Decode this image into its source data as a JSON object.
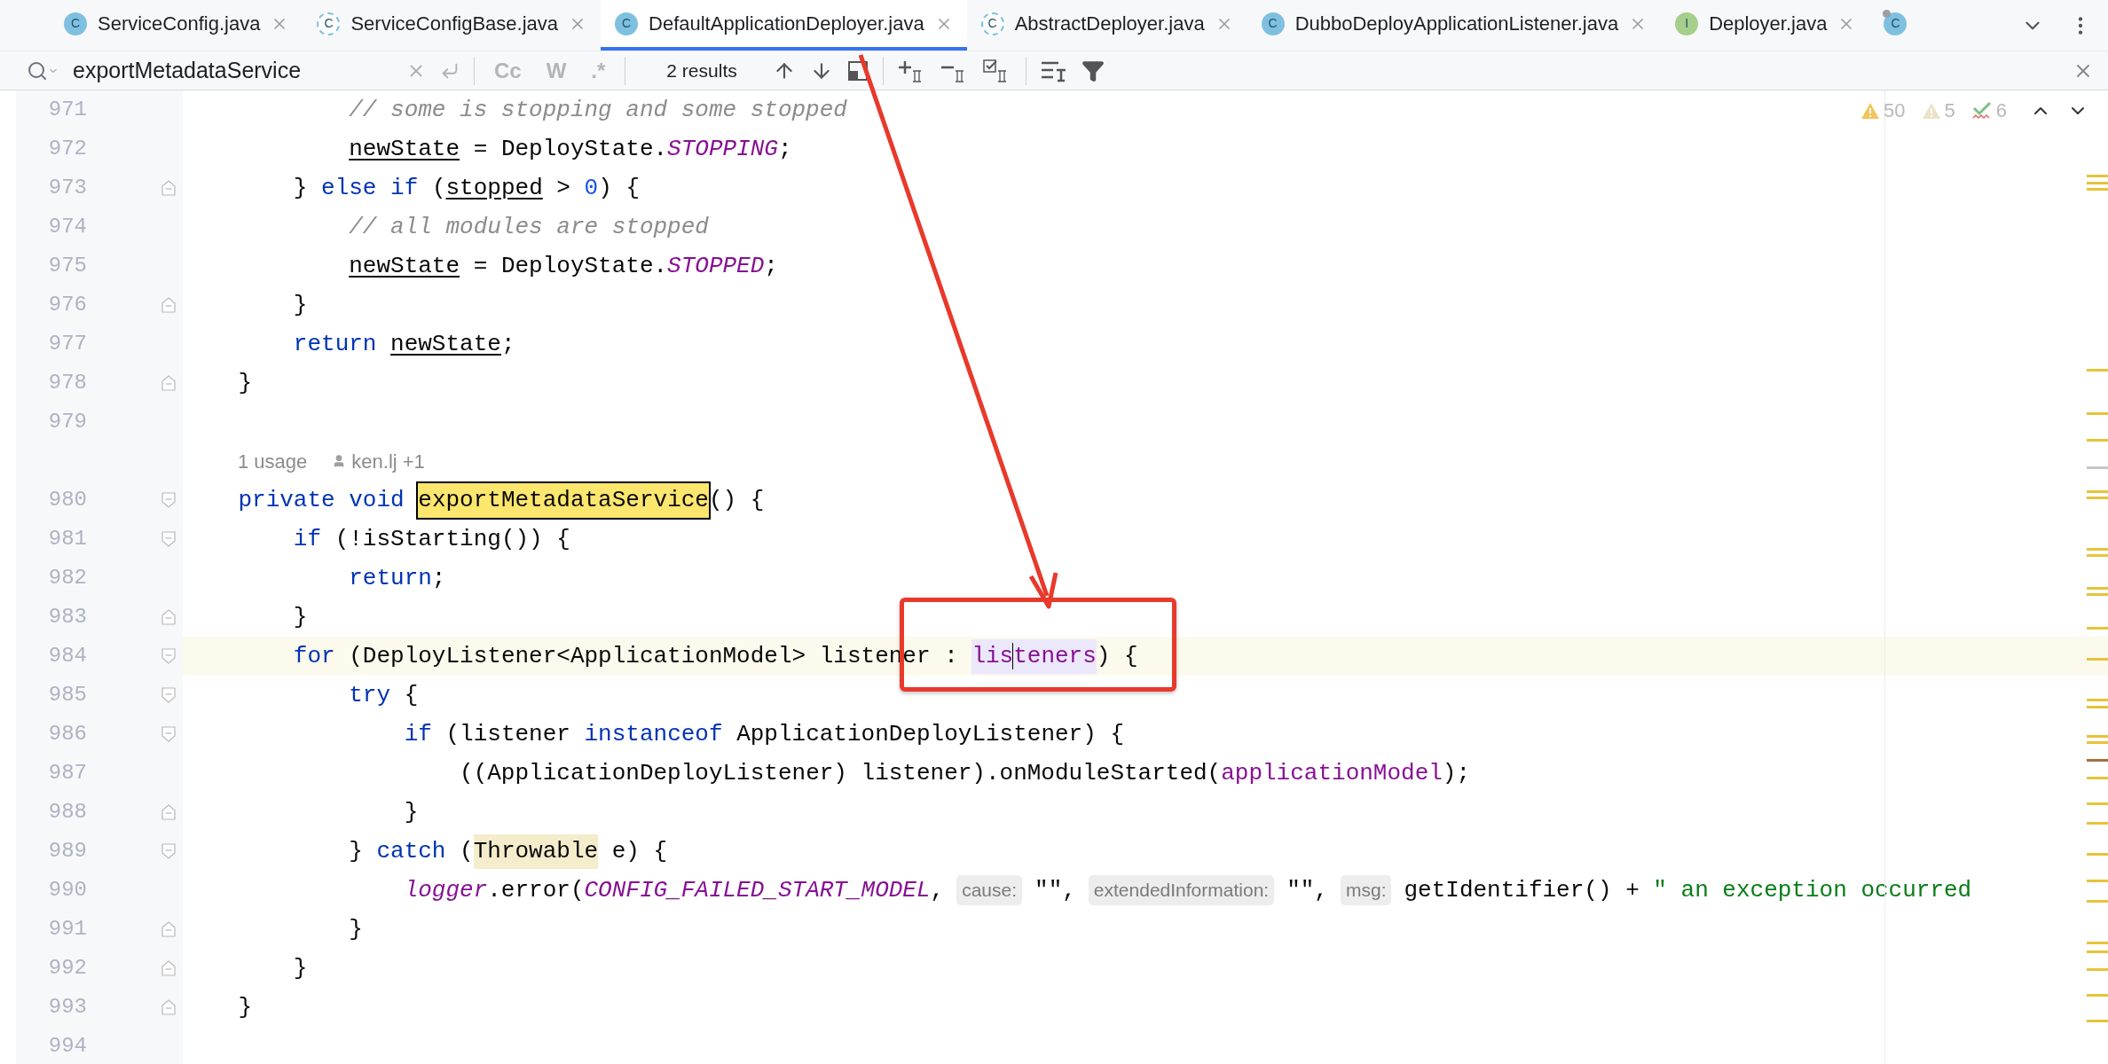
{
  "tabs": [
    {
      "icon": "C",
      "kind": "class",
      "label": "ServiceConfig.java",
      "selected": false
    },
    {
      "icon": "C",
      "kind": "abstract",
      "label": "ServiceConfigBase.java",
      "selected": false
    },
    {
      "icon": "C",
      "kind": "class",
      "label": "DefaultApplicationDeployer.java",
      "selected": true
    },
    {
      "icon": "C",
      "kind": "abstract",
      "label": "AbstractDeployer.java",
      "selected": false
    },
    {
      "icon": "C",
      "kind": "class",
      "label": "DubboDeployApplicationListener.java",
      "selected": false
    },
    {
      "icon": "I",
      "kind": "interface",
      "label": "Deployer.java",
      "selected": false
    },
    {
      "icon": "C",
      "kind": "pinned",
      "selected": false
    }
  ],
  "search": {
    "query": "exportMetadataService",
    "options": [
      "Cc",
      "W",
      ".*"
    ],
    "results": "2 results"
  },
  "inspections": [
    {
      "kind": "warning",
      "count": "50"
    },
    {
      "kind": "weak_warning",
      "count": "5"
    },
    {
      "kind": "typo",
      "count": "6"
    }
  ],
  "lines": [
    {
      "number": "971",
      "tokens": [
        {
          "text": "            // some is stopping and some stopped",
          "kind": "comment"
        }
      ]
    },
    {
      "number": "972",
      "tokens": [
        {
          "text": "            newState",
          "kind": "var"
        },
        {
          "text": " = DeployState.",
          "kind": "plain"
        },
        {
          "text": "STOPPING",
          "kind": "const"
        },
        {
          "text": ";",
          "kind": "plain"
        }
      ]
    },
    {
      "number": "973",
      "fold_start": false,
      "tokens": [
        {
          "text": "        } ",
          "kind": "plain"
        },
        {
          "text": "else ",
          "kind": "kw"
        },
        {
          "text": "if",
          "kind": "kw"
        },
        {
          "text": " (",
          "kind": "plain"
        },
        {
          "text": "stopped",
          "kind": "var"
        },
        {
          "text": " > ",
          "kind": "plain"
        },
        {
          "text": "0",
          "kind": "num"
        },
        {
          "text": ") {",
          "kind": "plain"
        }
      ]
    },
    {
      "number": "974",
      "tokens": [
        {
          "text": "            // all modules are stopped",
          "kind": "comment"
        }
      ]
    },
    {
      "number": "975",
      "tokens": [
        {
          "text": "            newState",
          "kind": "var"
        },
        {
          "text": " = DeployState.",
          "kind": "plain"
        },
        {
          "text": "STOPPED",
          "kind": "const"
        },
        {
          "text": ";",
          "kind": "plain"
        }
      ]
    },
    {
      "number": "976",
      "fold_start": false,
      "tokens": [
        {
          "text": "        }",
          "kind": "plain"
        }
      ]
    },
    {
      "number": "977",
      "tokens": [
        {
          "text": "        return ",
          "kind": "kw"
        },
        {
          "text": "newState",
          "kind": "var"
        },
        {
          "text": ";",
          "kind": "plain"
        }
      ]
    },
    {
      "number": "978",
      "fold_start": false,
      "tokens": [
        {
          "text": "    }",
          "kind": "plain"
        }
      ]
    },
    {
      "number": "979"
    },
    {
      "kind": "inlay",
      "usage": "1 usage",
      "author": "ken.lj +1"
    },
    {
      "number": "980",
      "fold_start": true,
      "tokens": [
        {
          "text": "    private ",
          "kind": "kw"
        },
        {
          "text": "void ",
          "kind": "kw"
        },
        {
          "text": "exportMetadataService",
          "kind": "match"
        },
        {
          "text": "() {",
          "kind": "plain"
        }
      ]
    },
    {
      "number": "981",
      "fold_start": true,
      "tokens": [
        {
          "text": "        if",
          "kind": "kw"
        },
        {
          "text": " (!isStarting()) {",
          "kind": "plain"
        }
      ]
    },
    {
      "number": "982",
      "tokens": [
        {
          "text": "            return",
          "kind": "kw"
        },
        {
          "text": ";",
          "kind": "plain"
        }
      ]
    },
    {
      "number": "983",
      "fold_start": false,
      "tokens": [
        {
          "text": "        }",
          "kind": "plain"
        }
      ]
    },
    {
      "number": "984",
      "fold_start": true,
      "current": true,
      "tokens": [
        {
          "text": "        for",
          "kind": "kw"
        },
        {
          "text": " (DeployListener<ApplicationModel> listener : ",
          "kind": "plain"
        },
        {
          "text": "lis",
          "kind": "usage",
          "caret": true
        },
        {
          "text": "teners",
          "kind": "usage"
        },
        {
          "text": ") {",
          "kind": "plain"
        }
      ]
    },
    {
      "number": "985",
      "fold_start": true,
      "tokens": [
        {
          "text": "            try",
          "kind": "kw"
        },
        {
          "text": " {",
          "kind": "plain"
        }
      ]
    },
    {
      "number": "986",
      "fold_start": true,
      "tokens": [
        {
          "text": "                if",
          "kind": "kw"
        },
        {
          "text": " (listener ",
          "kind": "plain"
        },
        {
          "text": "instanceof",
          "kind": "kw"
        },
        {
          "text": " ApplicationDeployListener) {",
          "kind": "plain"
        }
      ]
    },
    {
      "number": "987",
      "tokens": [
        {
          "text": "                    ((ApplicationDeployListener) listener).onModuleStarted(",
          "kind": "plain"
        },
        {
          "text": "applicationModel",
          "kind": "field"
        },
        {
          "text": ");",
          "kind": "plain"
        }
      ]
    },
    {
      "number": "988",
      "fold_start": false,
      "tokens": [
        {
          "text": "                }",
          "kind": "plain"
        }
      ]
    },
    {
      "number": "989",
      "fold_start": true,
      "tokens": [
        {
          "text": "            } ",
          "kind": "plain"
        },
        {
          "text": "catch",
          "kind": "kw"
        },
        {
          "text": " (",
          "kind": "plain"
        },
        {
          "text": "Throwable",
          "kind": "typehl"
        },
        {
          "text": " e) {",
          "kind": "plain"
        }
      ]
    },
    {
      "number": "990",
      "tokens": [
        {
          "text": "                logger",
          "kind": "const"
        },
        {
          "text": ".error(",
          "kind": "plain"
        },
        {
          "text": "CONFIG_FAILED_START_MODEL",
          "kind": "const"
        },
        {
          "text": ",",
          "kind": "plain"
        },
        {
          "text": "cause:",
          "kind": "hint"
        },
        {
          "text": "\"\",",
          "kind": "plain"
        },
        {
          "text": "extendedInformation:",
          "kind": "hint"
        },
        {
          "text": "\"\",",
          "kind": "plain"
        },
        {
          "text": "msg:",
          "kind": "hint"
        },
        {
          "text": "getIdentifier() +",
          "kind": "plain"
        },
        {
          "text": " \" an exception occurred",
          "kind": "str"
        }
      ]
    },
    {
      "number": "991",
      "fold_start": false,
      "tokens": [
        {
          "text": "            }",
          "kind": "plain"
        }
      ]
    },
    {
      "number": "992",
      "fold_start": false,
      "tokens": [
        {
          "text": "        }",
          "kind": "plain"
        }
      ]
    },
    {
      "number": "993",
      "fold_start": false,
      "tokens": [
        {
          "text": "    }",
          "kind": "plain"
        }
      ]
    },
    {
      "number": "994"
    }
  ]
}
